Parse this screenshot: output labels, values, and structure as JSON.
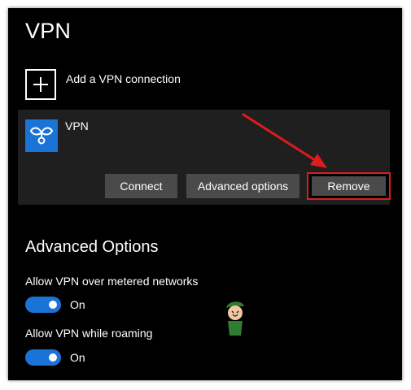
{
  "page": {
    "title": "VPN"
  },
  "add_connection": {
    "label": "Add a VPN connection",
    "icon": "plus-icon"
  },
  "vpn_item": {
    "name": "VPN",
    "icon": "vpn-icon",
    "buttons": {
      "connect": "Connect",
      "advanced": "Advanced options",
      "remove": "Remove"
    }
  },
  "advanced_options": {
    "title": "Advanced Options",
    "metered": {
      "label": "Allow VPN over metered networks",
      "state": "On",
      "enabled": true
    },
    "roaming": {
      "label": "Allow VPN while roaming",
      "state": "On",
      "enabled": true
    }
  },
  "colors": {
    "accent": "#1b73d8",
    "highlight": "#e01b1b",
    "background": "#000000",
    "card": "#1f1f1f",
    "button": "#4a4a4a"
  }
}
